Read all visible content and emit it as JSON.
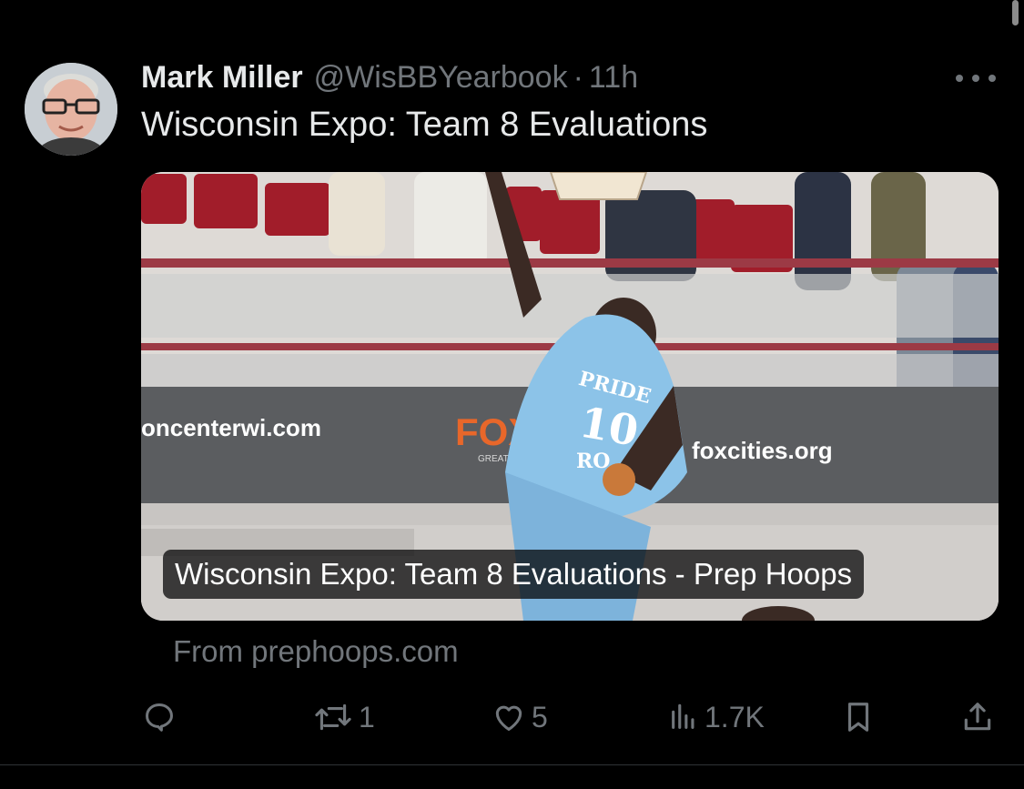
{
  "author": {
    "name": "Mark Miller",
    "handle": "@WisBBYearbook",
    "separator": "·",
    "time": "11h"
  },
  "tweet": {
    "text": "Wisconsin Expo: Team 8 Evaluations"
  },
  "card": {
    "title": "Wisconsin Expo: Team 8 Evaluations - Prep Hoops",
    "source": "From prephoops.com",
    "image_text": {
      "banner_left": "oncenterwi.com",
      "banner_brand": "FOX",
      "banner_brand_sub": "GREATER",
      "banner_right": "foxcities.org",
      "jersey_top": "PRIDE",
      "jersey_number": "10",
      "jersey_bottom": "RO"
    }
  },
  "actions": {
    "reply_icon": "reply-icon",
    "retweet_icon": "retweet-icon",
    "retweet_count": "1",
    "like_icon": "heart-icon",
    "like_count": "5",
    "views_icon": "views-icon",
    "views_count": "1.7K",
    "bookmark_icon": "bookmark-icon",
    "share_icon": "share-icon"
  },
  "colors": {
    "background": "#000000",
    "text_primary": "#e7e9ea",
    "text_secondary": "#71767b",
    "jersey": "#8cc3e8",
    "seats": "#a11d2a",
    "brand_orange": "#e8672a"
  }
}
